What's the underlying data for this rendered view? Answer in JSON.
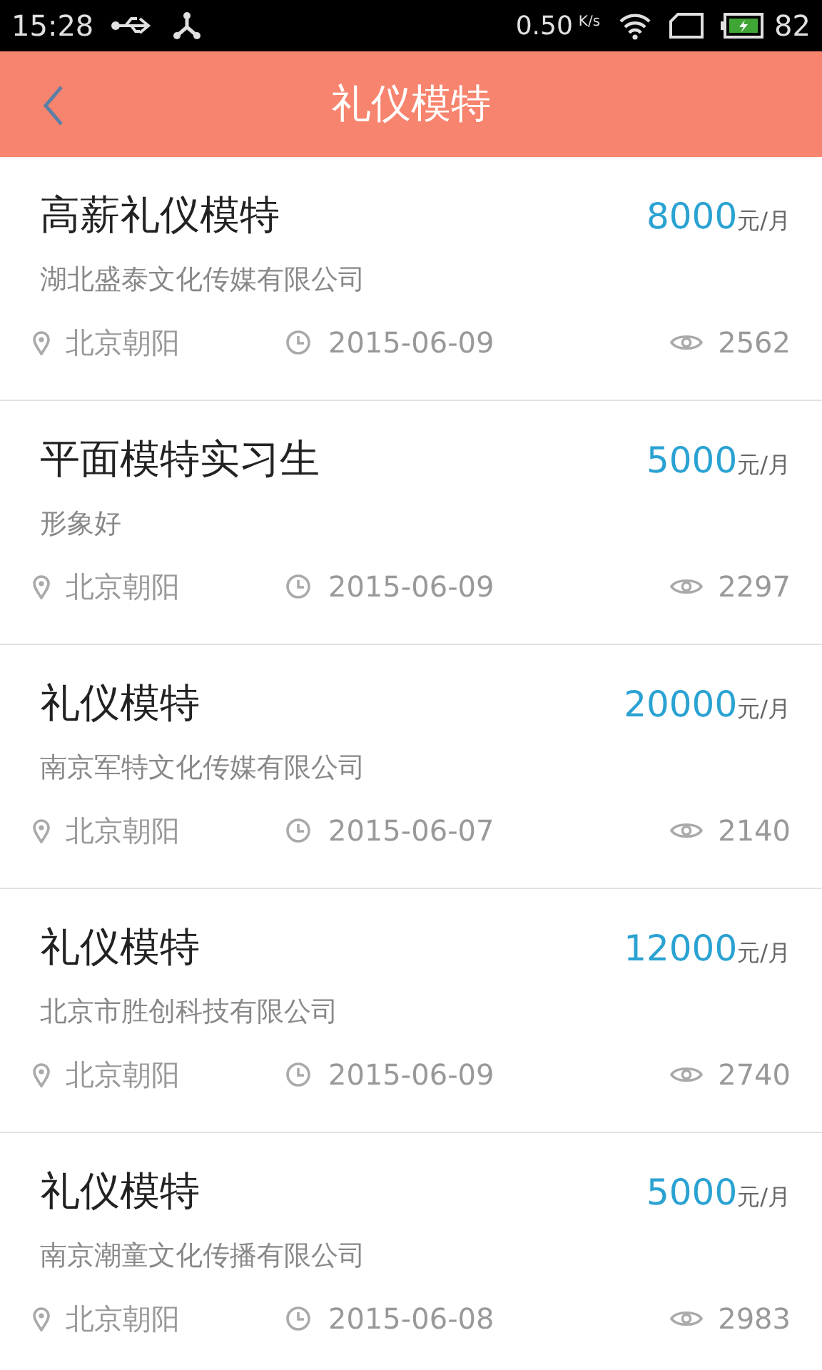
{
  "status_bar": {
    "time": "15:28",
    "speed": "0.50",
    "speed_unit": "K/s",
    "battery": "82"
  },
  "header": {
    "title": "礼仪模特"
  },
  "jobs": [
    {
      "title": "高薪礼仪模特",
      "salary": "8000",
      "unit": "元/月",
      "company": "湖北盛泰文化传媒有限公司",
      "location": "北京朝阳",
      "date": "2015-06-09",
      "views": "2562"
    },
    {
      "title": "平面模特实习生",
      "salary": "5000",
      "unit": "元/月",
      "company": "形象好",
      "location": "北京朝阳",
      "date": "2015-06-09",
      "views": "2297"
    },
    {
      "title": "礼仪模特",
      "salary": "20000",
      "unit": "元/月",
      "company": "南京军特文化传媒有限公司",
      "location": "北京朝阳",
      "date": "2015-06-07",
      "views": "2140"
    },
    {
      "title": "礼仪模特",
      "salary": "12000",
      "unit": "元/月",
      "company": "北京市胜创科技有限公司",
      "location": "北京朝阳",
      "date": "2015-06-09",
      "views": "2740"
    },
    {
      "title": "礼仪模特",
      "salary": "5000",
      "unit": "元/月",
      "company": "南京潮童文化传播有限公司",
      "location": "北京朝阳",
      "date": "2015-06-08",
      "views": "2983"
    }
  ]
}
